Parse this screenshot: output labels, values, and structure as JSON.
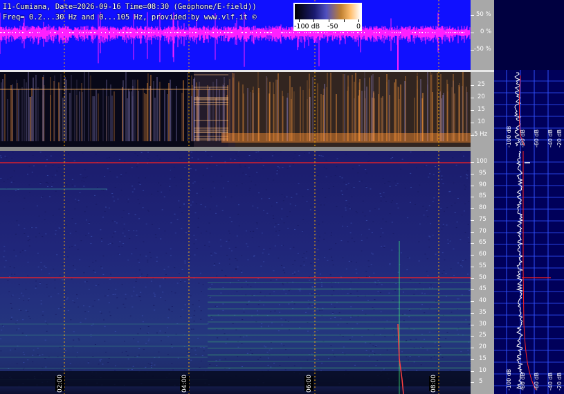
{
  "header": {
    "line1": "I1-Cumiana, Date=2026-09-16 Time=08:30 (Geophone/E-field))",
    "line2": "Freq= 0.2...30 Hz and 0...105 Hz, provided by www.vlf.it ©"
  },
  "colorbar": {
    "labels": [
      "-100 dB",
      "-50",
      "0"
    ]
  },
  "waveform_axis": [
    "50 %",
    "0 %",
    "-50 %"
  ],
  "spectrogram_low": {
    "freq_labels": [
      "25",
      "20",
      "15",
      "10",
      "-5 Hz"
    ]
  },
  "spectrogram_high": {
    "freq_labels": [
      "100",
      "95",
      "90",
      "85",
      "80",
      "75",
      "70",
      "65",
      "60",
      "55",
      "50",
      "45",
      "40",
      "35",
      "30",
      "25",
      "20",
      "15",
      "10",
      "5"
    ]
  },
  "time_labels": [
    "02:00",
    "04:00",
    "06:00",
    "08:00"
  ],
  "side_panel_top": {
    "db_labels": [
      "-100 dB",
      "-80 dB",
      "-60 dB",
      "-40 dB",
      "-20 dB"
    ]
  },
  "side_panel_bottom": {
    "db_labels": [
      "-100 dB",
      "-80 dB",
      "-60 dB",
      "-40 dB",
      "-20 dB"
    ]
  },
  "colors": {
    "waveform_bg": "#1010ff",
    "waveform_trace": "#ff20ff",
    "axis_bg": "#a8a8a8",
    "grid_line": "#ffb000",
    "hum_line": "#ff2020",
    "side_bg": "#00005a"
  }
}
